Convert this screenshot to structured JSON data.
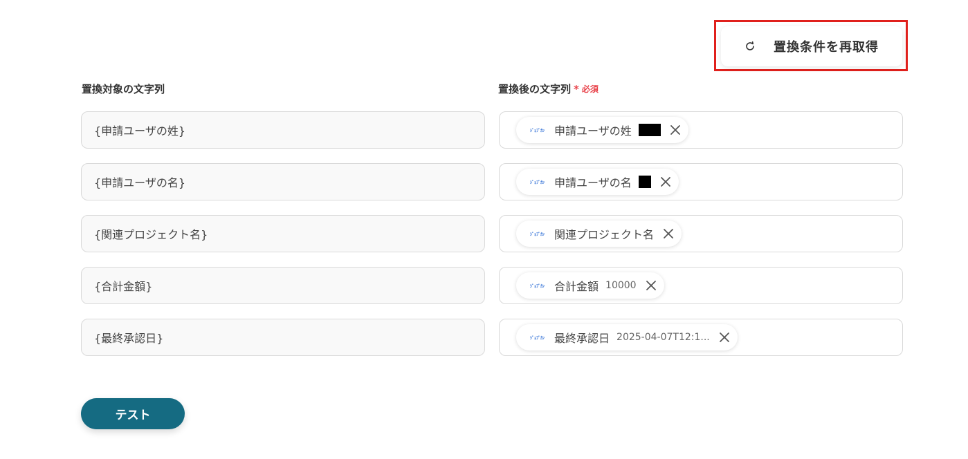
{
  "toolbar": {
    "refetch_label": "置換条件を再取得",
    "refetch_icon": "refresh-icon"
  },
  "headers": {
    "target_label": "置換対象の文字列",
    "replacement_label": "置換後の文字列",
    "required_mark": "*",
    "required_text": "必須"
  },
  "rows": [
    {
      "target": "{申請ユーザの姓}",
      "chip": {
        "app_logo": "ｼﾞｮﾌﾞｶﾝ",
        "label": "申請ユーザの姓",
        "value": ""
      }
    },
    {
      "target": "{申請ユーザの名}",
      "chip": {
        "app_logo": "ｼﾞｮﾌﾞｶﾝ",
        "label": "申請ユーザの名",
        "value": ""
      }
    },
    {
      "target": "{関連プロジェクト名}",
      "chip": {
        "app_logo": "ｼﾞｮﾌﾞｶﾝ",
        "label": "関連プロジェクト名",
        "value": ""
      }
    },
    {
      "target": "{合計金額}",
      "chip": {
        "app_logo": "ｼﾞｮﾌﾞｶﾝ",
        "label": "合計金額",
        "value": "10000"
      }
    },
    {
      "target": "{最終承認日}",
      "chip": {
        "app_logo": "ｼﾞｮﾌﾞｶﾝ",
        "label": "最終承認日",
        "value": "2025-04-07T12:1..."
      }
    }
  ],
  "actions": {
    "test_label": "テスト"
  },
  "colors": {
    "primary": "#156b82",
    "highlight": "#e0201c",
    "required": "#e8424a",
    "app_logo": "#2f6fd6"
  }
}
